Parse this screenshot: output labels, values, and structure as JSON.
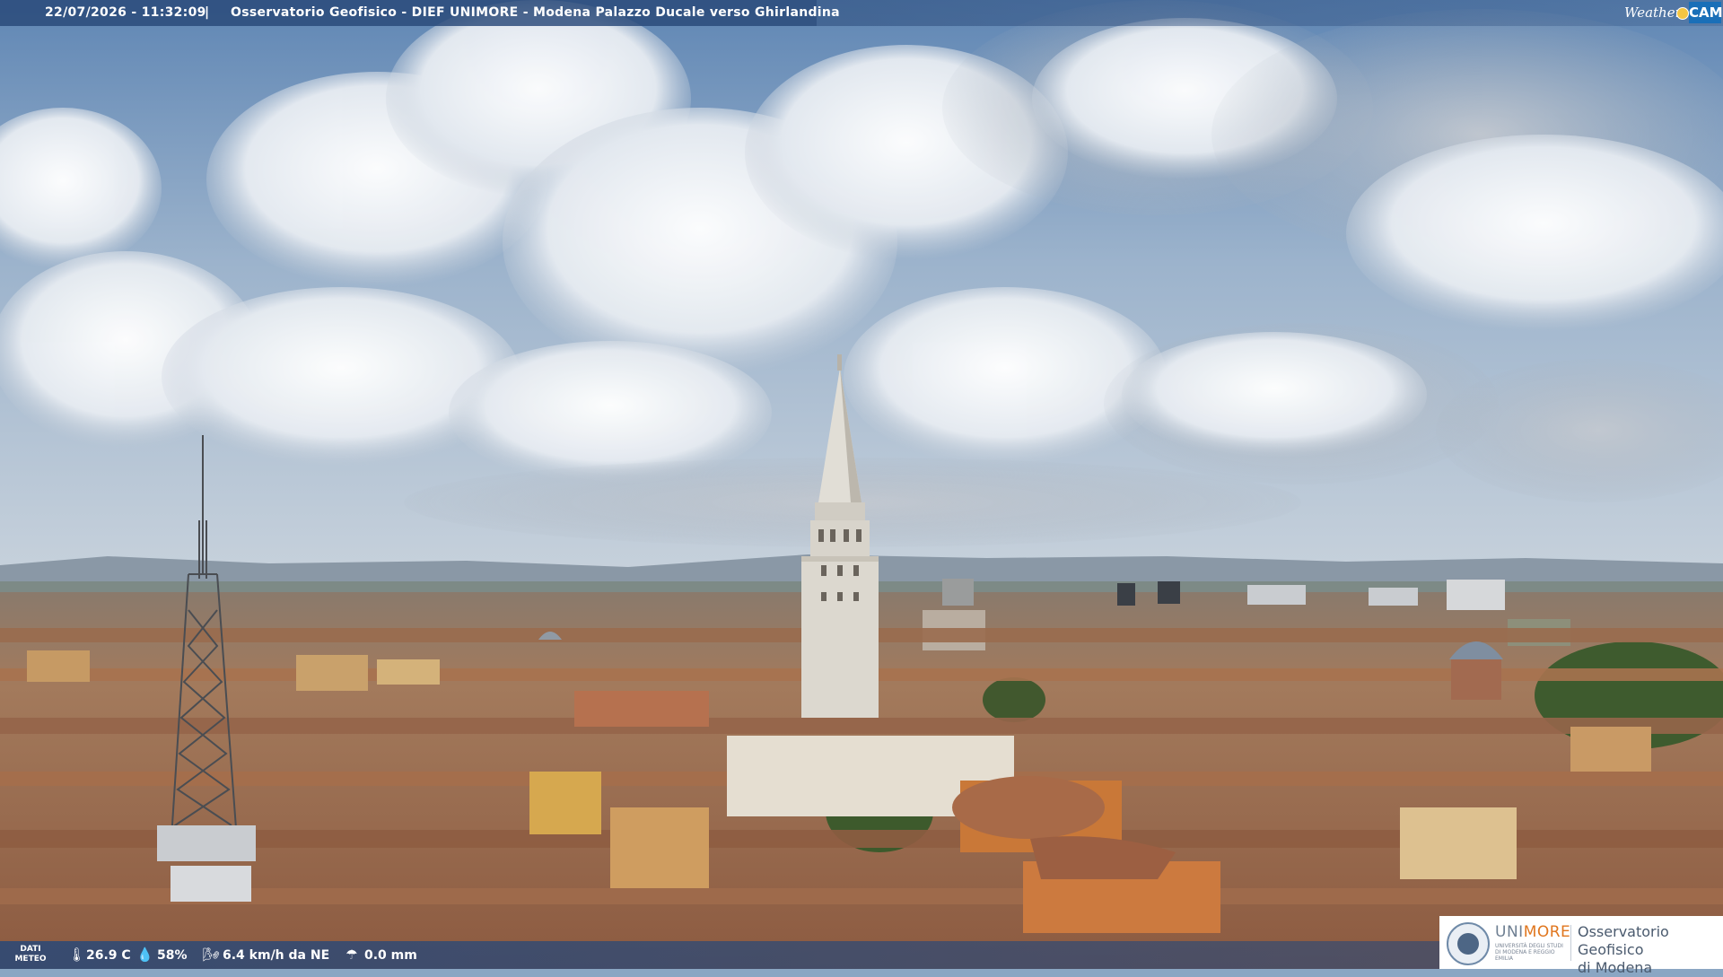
{
  "header": {
    "datetime": "22/07/2026 - 11:32:09",
    "separator": "|",
    "title": "Osservatorio Geofisico - DIEF UNIMORE - Modena Palazzo Ducale verso Ghirlandina",
    "logo": {
      "word": "Weather",
      "badge": "CAM"
    }
  },
  "weather": {
    "label_line1": "DATI",
    "label_line2": "METEO",
    "temperature": "26.9 C",
    "humidity": "58%",
    "wind": "6.4 km/h da NE",
    "rain": "0.0 mm",
    "icons": [
      "thermometer-icon",
      "humidity-drop-icon",
      "wind-icon",
      "rain-gauge-icon"
    ]
  },
  "institution": {
    "brand_uni": "UNI",
    "brand_more": "MORE",
    "subline": "UNIVERSITÀ DEGLI STUDI DI MODENA E REGGIO EMILIA",
    "observatory_line1": "Osservatorio Geofisico",
    "observatory_line2": "di Modena"
  },
  "colors": {
    "bar": "#284878",
    "sky_top": "#5f86b4",
    "roof": "#a9704f",
    "tower": "#dcd8cf",
    "brand_orange": "#e0761e"
  }
}
